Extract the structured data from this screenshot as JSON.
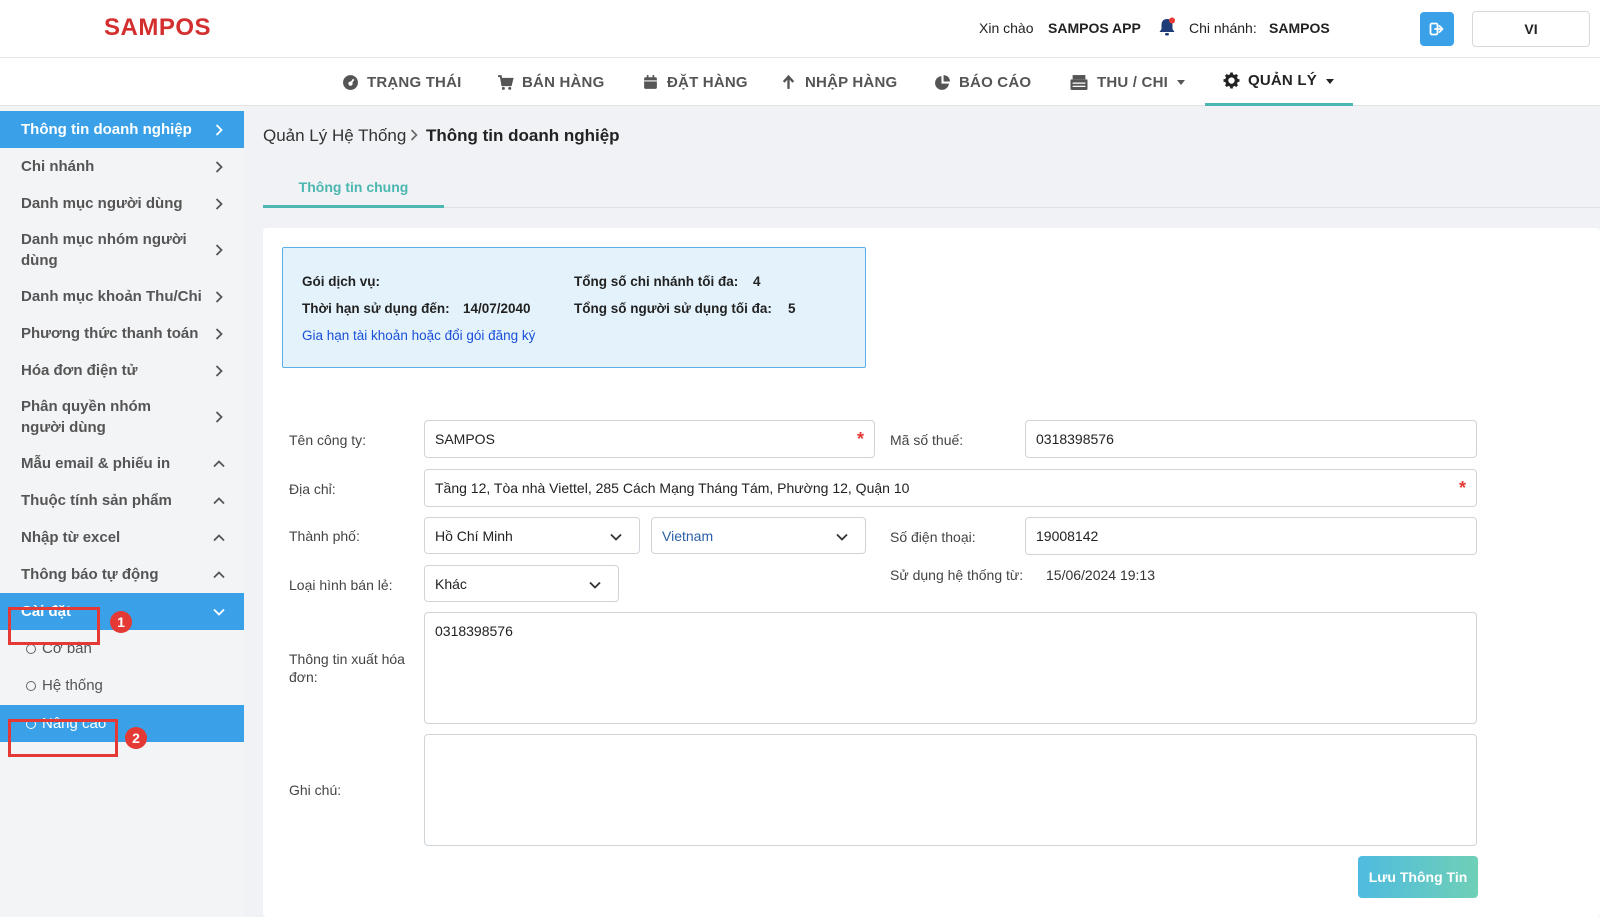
{
  "header": {
    "logo": "SAMPOS",
    "greeting": "Xin chào",
    "user": "SAMPOS APP",
    "branch_label": "Chi nhánh:",
    "branch_value": "SAMPOS",
    "lang": "VI"
  },
  "nav": [
    {
      "label": "TRẠNG THÁI",
      "icon": "dashboard-icon"
    },
    {
      "label": "BÁN HÀNG",
      "icon": "cart-icon"
    },
    {
      "label": "ĐẶT HÀNG",
      "icon": "calendar-icon"
    },
    {
      "label": "NHẬP HÀNG",
      "icon": "arrow-up-icon"
    },
    {
      "label": "BÁO CÁO",
      "icon": "pie-chart-icon"
    },
    {
      "label": "THU / CHI",
      "icon": "cash-register-icon"
    },
    {
      "label": "QUẢN LÝ",
      "icon": "gear-icon"
    }
  ],
  "sidebar": {
    "items": [
      {
        "label": "Thông tin doanh nghiệp"
      },
      {
        "label": "Chi nhánh"
      },
      {
        "label": "Danh mục người dùng"
      },
      {
        "label": "Danh mục nhóm người dùng"
      },
      {
        "label": "Danh mục khoản Thu/Chi"
      },
      {
        "label": "Phương thức thanh toán"
      },
      {
        "label": "Hóa đơn điện tử"
      },
      {
        "label": "Phân quyền nhóm người dùng"
      },
      {
        "label": "Mẫu email & phiếu in"
      },
      {
        "label": "Thuộc tính sản phẩm"
      },
      {
        "label": "Nhập từ excel"
      },
      {
        "label": "Thông báo tự động"
      },
      {
        "label": "Cài đặt"
      }
    ],
    "sub_items": [
      {
        "label": "Cơ bản"
      },
      {
        "label": "Hệ thống"
      },
      {
        "label": "Nâng cao"
      }
    ],
    "badges": [
      "1",
      "2"
    ]
  },
  "breadcrumb": {
    "parent": "Quản Lý Hệ Thống",
    "current": "Thông tin doanh nghiệp"
  },
  "tabs": [
    "Thông tin chung"
  ],
  "info": {
    "service_label": "Gói dịch vụ:",
    "expiry_label": "Thời hạn sử dụng đến:",
    "expiry_value": "14/07/2040",
    "link": "Gia hạn tài khoản hoặc đổi gói đăng ký",
    "max_branch_label": "Tổng số chi nhánh tối đa:",
    "max_branch_value": "4",
    "max_user_label": "Tổng số người sử dụng tối đa:",
    "max_user_value": "5"
  },
  "form": {
    "company_label": "Tên công ty:",
    "company_value": "SAMPOS",
    "tax_label": "Mã số thuế:",
    "tax_value": "0318398576",
    "address_label": "Địa chỉ:",
    "address_value": "Tầng 12, Tòa nhà Viettel, 285 Cách Mạng Tháng Tám, Phường 12, Quận 10",
    "city_label": "Thành phố:",
    "city_value": "Hồ Chí Minh",
    "country_value": "Vietnam",
    "phone_label": "Số điện thoại:",
    "phone_value": "19008142",
    "since_label": "Sử dụng hệ thống từ:",
    "since_value": "15/06/2024 19:13",
    "retail_label": "Loại hình bán lẻ:",
    "retail_value": "Khác",
    "invoice_label": "Thông tin xuất hóa đơn:",
    "invoice_value": "0318398576",
    "note_label": "Ghi chú:",
    "note_value": "",
    "required_mark": "*"
  },
  "save_button": "Lưu Thông Tin",
  "colors": {
    "brand_red": "#d32f2f",
    "primary_blue": "#3aa0e8",
    "accent_teal": "#4cb6b0",
    "highlight_red": "#e53935"
  }
}
